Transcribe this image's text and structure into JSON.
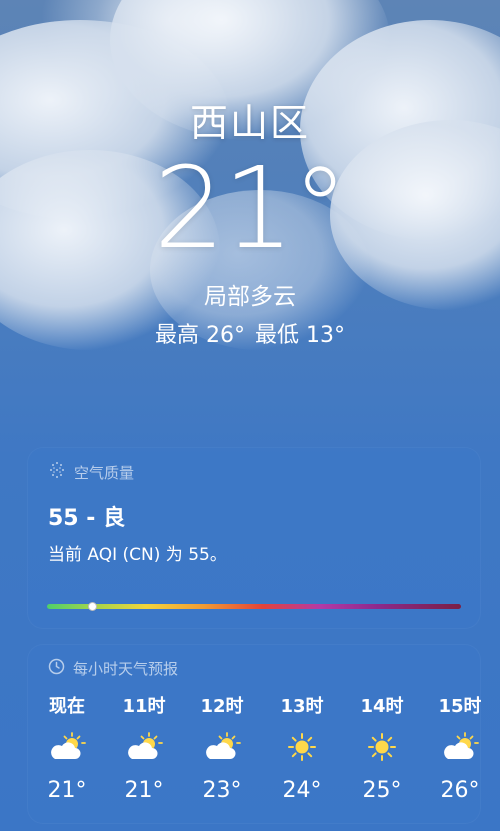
{
  "location": "西山区",
  "current_temp": "21°",
  "condition": "局部多云",
  "high": "最高 26°",
  "low": "最低 13°",
  "air_quality": {
    "title": "空气质量",
    "value_text": "55 - 良",
    "description": "当前 AQI (CN) 为 55。",
    "aqi": 55,
    "icon": "air-quality-icon"
  },
  "hourly": {
    "title": "每小时天气预报",
    "icon": "clock-icon",
    "items": [
      {
        "label": "现在",
        "icon": "partly-cloudy-icon",
        "temp": "21°"
      },
      {
        "label": "11时",
        "icon": "partly-cloudy-icon",
        "temp": "21°"
      },
      {
        "label": "12时",
        "icon": "partly-cloudy-icon",
        "temp": "23°"
      },
      {
        "label": "13时",
        "icon": "sun-icon",
        "temp": "24°"
      },
      {
        "label": "14时",
        "icon": "sun-icon",
        "temp": "25°"
      },
      {
        "label": "15时",
        "icon": "partly-cloudy-icon",
        "temp": "26°"
      }
    ]
  }
}
